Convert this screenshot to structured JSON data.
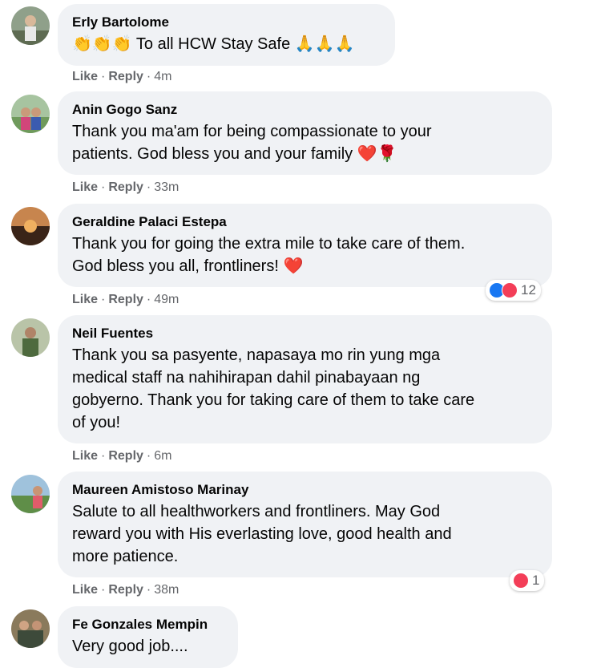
{
  "comments": [
    {
      "author": "Erly Bartolome",
      "lines": [
        "👏👏👏 To all HCW Stay Safe 🙏🙏🙏"
      ],
      "like": "Like",
      "reply": "Reply",
      "time": "4m"
    },
    {
      "author": "Anin Gogo Sanz",
      "lines": [
        "Thank you ma'am for being compassionate to your",
        "patients. God bless you and your family ❤️🌹"
      ],
      "like": "Like",
      "reply": "Reply",
      "time": "33m"
    },
    {
      "author": "Geraldine Palaci Estepa",
      "lines": [
        "Thank you for going the extra mile to take care of them.",
        "God bless you all, frontliners! ❤️"
      ],
      "like": "Like",
      "reply": "Reply",
      "time": "49m",
      "reaction_count": "12"
    },
    {
      "author": "Neil Fuentes",
      "lines": [
        "Thank you sa pasyente, napasaya mo rin yung mga",
        "medical staff na nahihirapan dahil pinabayaan ng",
        "gobyerno. Thank you for taking care of them to take care",
        "of you!"
      ],
      "like": "Like",
      "reply": "Reply",
      "time": "6m"
    },
    {
      "author": "Maureen Amistoso Marinay",
      "lines": [
        "Salute to all healthworkers and frontliners. May God",
        "reward you with His everlasting love, good health and",
        "more patience."
      ],
      "like": "Like",
      "reply": "Reply",
      "time": "38m",
      "reaction_count": "1"
    },
    {
      "author": "Fe Gonzales Mempin",
      "lines": [
        "Very good job...."
      ]
    }
  ],
  "colors": {
    "bubble": "#f0f2f5",
    "meta": "#65676b",
    "like": "#1877f2",
    "love": "#f33e58"
  }
}
